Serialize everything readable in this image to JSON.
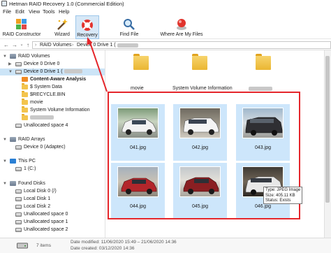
{
  "window": {
    "title": "Hetman RAID Recovery 1.0 (Commercial Edition)"
  },
  "menu": [
    "File",
    "Edit",
    "View",
    "Tools",
    "Help"
  ],
  "ribbon": {
    "raid_constructor": "RAID Constructor",
    "wizard": "Wizard",
    "recovery": "Recovery",
    "find_file": "Find File",
    "where_are_my_files": "Where Are My Files"
  },
  "address": {
    "segments": [
      "RAID Volumes",
      "Device 0 Drive 1 ("
    ]
  },
  "tree": {
    "raid_volumes": "RAID Volumes",
    "device0drive0": "Device 0 Drive 0",
    "device0drive1": "Device 0 Drive 1 (",
    "content_aware": "Content-Aware Analysis",
    "system_data": "$ System Data",
    "recycle": "$RECYCLE.BIN",
    "movie": "movie",
    "svi": "System Volume Information",
    "unalloc4": "Unallocated space 4",
    "raid_arrays": "RAID Arrays",
    "adaptec": "Device 0 (Adaptec)",
    "this_pc": "This PC",
    "c_drive": "1 (C:)",
    "found_disks": "Found Disks",
    "local0": "Local Disk 0 (/)",
    "local1": "Local Disk 1",
    "local2": "Local Disk 2",
    "unalloc0": "Unallocated space 0",
    "unalloc1": "Unallocated space 1",
    "unalloc2": "Unallocated space 2"
  },
  "content": {
    "folders": [
      "movie",
      "System Volume Information"
    ],
    "files": [
      "041.jpg",
      "042.jpg",
      "043.jpg",
      "044.jpg",
      "045.jpg",
      "046.jpg"
    ]
  },
  "tooltip": {
    "type": "Type: JPEG Image",
    "size": "Size: 405.11 KB",
    "status": "Status: Exists"
  },
  "status": {
    "count": "7 items",
    "modified_label": "Date modified: 11/06/2020 15:49 – 21/06/2020 14:36",
    "created_label": "Date created: 03/12/2020 14:36"
  },
  "colors": {
    "selection": "#cce4f7",
    "tile_selection": "#cde6fb",
    "highlight": "#e5262b"
  }
}
